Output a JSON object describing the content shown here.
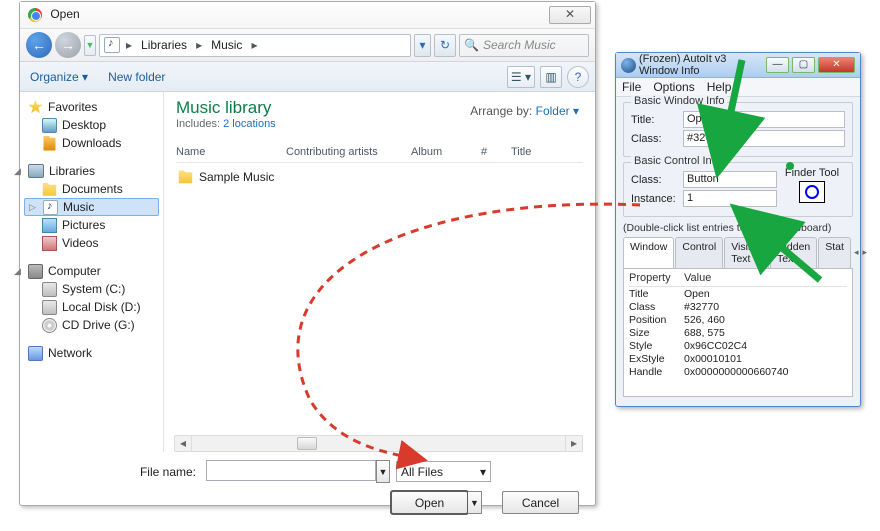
{
  "open": {
    "title": "Open",
    "breadcrumb": {
      "root": "Libraries",
      "child": "Music"
    },
    "search_placeholder": "Search Music",
    "toolbar": {
      "organize": "Organize ▾",
      "newfolder": "New folder"
    },
    "sidebar": {
      "favorites": {
        "label": "Favorites",
        "items": [
          "Desktop",
          "Downloads"
        ]
      },
      "libraries": {
        "label": "Libraries",
        "items": [
          "Documents",
          "Music",
          "Pictures",
          "Videos"
        ],
        "selected": "Music"
      },
      "computer": {
        "label": "Computer",
        "items": [
          "System (C:)",
          "Local Disk (D:)",
          "CD Drive (G:)"
        ]
      },
      "network": {
        "label": "Network"
      }
    },
    "library": {
      "heading": "Music library",
      "includes_prefix": "Includes:",
      "includes_link": "2 locations",
      "arrange_prefix": "Arrange by:",
      "arrange_value": "Folder ▾",
      "columns": [
        "Name",
        "Contributing artists",
        "Album",
        "#",
        "Title"
      ],
      "rows": [
        {
          "name": "Sample Music"
        }
      ]
    },
    "bottom": {
      "filename_label": "File name:",
      "filename_value": "",
      "filter": "All Files",
      "open_btn": "Open",
      "cancel_btn": "Cancel"
    }
  },
  "autoit": {
    "title": "(Frozen) AutoIt v3 Window Info",
    "menu": [
      "File",
      "Options",
      "Help"
    ],
    "basic_window": {
      "legend": "Basic Window Info",
      "title_label": "Title:",
      "title_value": "Open",
      "class_label": "Class:",
      "class_value": "#32770"
    },
    "basic_control": {
      "legend": "Basic Control Info",
      "class_label": "Class:",
      "class_value": "Button",
      "instance_label": "Instance:",
      "instance_value": "1"
    },
    "finder_label": "Finder Tool",
    "hint": "(Double-click list entries to copy to clipboard)",
    "tabs": [
      "Window",
      "Control",
      "Visible Text",
      "Hidden Text",
      "Stat"
    ],
    "prop_header": [
      "Property",
      "Value"
    ],
    "props": [
      [
        "Title",
        "Open"
      ],
      [
        "Class",
        "#32770"
      ],
      [
        "Position",
        "526, 460"
      ],
      [
        "Size",
        "688, 575"
      ],
      [
        "Style",
        "0x96CC02C4"
      ],
      [
        "ExStyle",
        "0x00010101"
      ],
      [
        "Handle",
        "0x0000000000660740"
      ]
    ]
  }
}
